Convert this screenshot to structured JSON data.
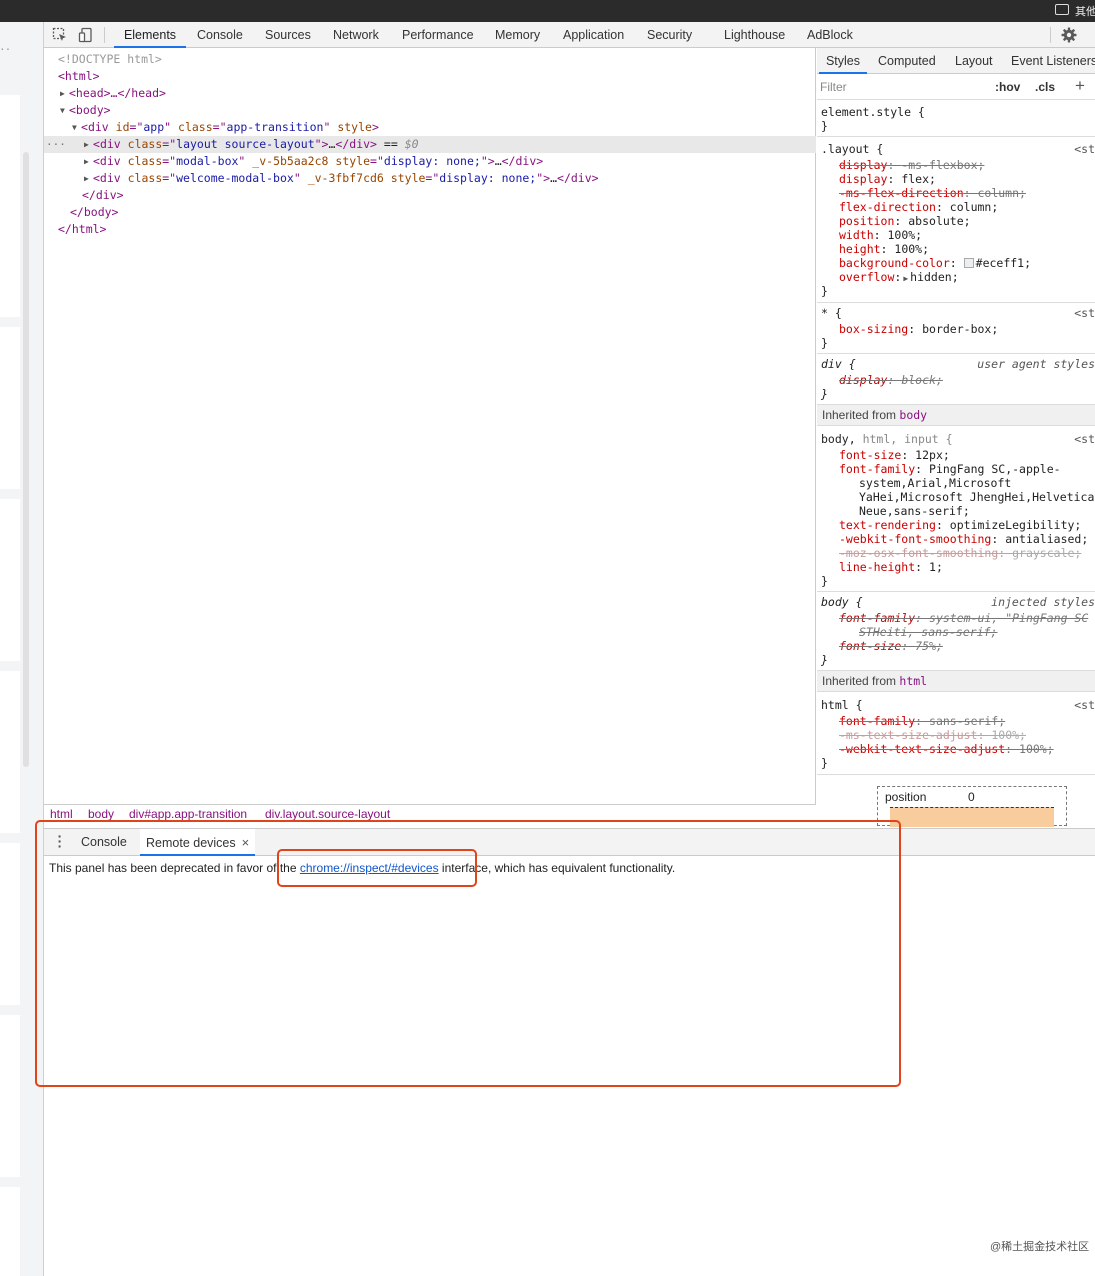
{
  "topbar": {
    "corner_text": "其他"
  },
  "leftstrip": {
    "dots": "··"
  },
  "toolbar": {
    "tabs": [
      "Elements",
      "Console",
      "Sources",
      "Network",
      "Performance",
      "Memory",
      "Application",
      "Security",
      "Lighthouse",
      "AdBlock"
    ],
    "active_tab": "Elements",
    "icons": [
      "inspect-element-icon",
      "device-toolbar-icon",
      "gear-icon"
    ]
  },
  "dom": {
    "doctype": "<!DOCTYPE html>",
    "html_open": "<html>",
    "head": "<head>…</head>",
    "body_open": "<body>",
    "app_div": {
      "tag": "div",
      "id_attr": "id",
      "id_val": "app",
      "class_attr": "class",
      "class_val": "app-transition",
      "style_attr": "style"
    },
    "selected_div": {
      "tag": "div",
      "class_attr": "class",
      "class_val": "layout source-layout",
      "ellipsis": "…",
      "close": "</div>",
      "eq": "==",
      "dollar": "$0",
      "dots": "···"
    },
    "modal_div": {
      "class_val": "modal-box",
      "scope": "_v-5b5aa2c8",
      "style_attr": "style",
      "style_val": "display: none;",
      "ellipsis": "…",
      "close": "</div>"
    },
    "welcome_div": {
      "class_val": "welcome-modal-box",
      "scope": "_v-3fbf7cd6",
      "style_attr": "style",
      "style_val": "display: none;",
      "ellipsis": "…",
      "close": "</div>"
    },
    "div_close": "</div>",
    "body_close": "</body>",
    "html_close": "</html>"
  },
  "breadcrumb": [
    "html",
    "body",
    "div#app.app-transition",
    "div.layout.source-layout"
  ],
  "sidebar": {
    "tabs": [
      "Styles",
      "Computed",
      "Layout",
      "Event Listeners"
    ],
    "active_tab": "Styles",
    "filter_placeholder": "Filter",
    "hov": ":hov",
    "cls": ".cls",
    "plus": "+",
    "element_style": "element.style {",
    "close_brace": "}",
    "layout_rule": {
      "selector": ".layout {",
      "source": "<st",
      "decls": [
        {
          "p": "display",
          "v": "-ms-flexbox;",
          "struck": true
        },
        {
          "p": "display",
          "v": "flex;",
          "struck": false
        },
        {
          "p": "-ms-flex-direction",
          "v": "column;",
          "struck": true
        },
        {
          "p": "flex-direction",
          "v": "column;",
          "struck": false
        },
        {
          "p": "position",
          "v": "absolute;",
          "struck": false
        },
        {
          "p": "width",
          "v": "100%;",
          "struck": false
        },
        {
          "p": "height",
          "v": "100%;",
          "struck": false
        },
        {
          "p": "background-color",
          "v": "#eceff1;",
          "struck": false
        },
        {
          "p": "overflow",
          "v": "hidden;",
          "struck": false
        }
      ]
    },
    "star_rule": {
      "selector": "* {",
      "source": "<st",
      "p": "box-sizing",
      "v": "border-box;"
    },
    "div_rule": {
      "selector": "div {",
      "source": "user agent styles",
      "p": "display",
      "v": "block;"
    },
    "inherited_body": {
      "label": "Inherited from",
      "tag": "body"
    },
    "body_rule": {
      "selector_a": "body,",
      "selector_b": "html, input {",
      "source": "<st",
      "font_size_p": "font-size",
      "font_size_v": "12px;",
      "ff_p": "font-family",
      "ff_v1": "PingFang SC,-apple-",
      "ff_v2": "system,Arial,Microsoft",
      "ff_v3": "YaHei,Microsoft JhengHei,Helvetica",
      "ff_v4": "Neue,sans-serif;",
      "tr_p": "text-rendering",
      "tr_v": "optimizeLegibility;",
      "wfs_p": "-webkit-font-smoothing",
      "wfs_v": "antialiased;",
      "moz_p": "-moz-osx-font-smoothing",
      "moz_v": "grayscale;",
      "lh_p": "line-height",
      "lh_v": "1;"
    },
    "body_injected": {
      "selector": "body {",
      "source": "injected styles",
      "ff_p": "font-family",
      "ff_v1": "system-ui, \"PingFang SC",
      "ff_v2": "STHeiti, sans-serif;",
      "fs_p": "font-size",
      "fs_v": "75%;"
    },
    "inherited_html": {
      "label": "Inherited from",
      "tag": "html"
    },
    "html_rule": {
      "selector": "html {",
      "source": "<st",
      "ff_p": "font-family",
      "ff_v": "sans-serif;",
      "ms_p": "-ms-text-size-adjust",
      "ms_v": "100%;",
      "wk_p": "-webkit-text-size-adjust",
      "wk_v": "100%;"
    },
    "boxmodel": {
      "label": "position",
      "value": "0"
    }
  },
  "drawer": {
    "tabs": [
      "Console",
      "Remote devices"
    ],
    "active_tab": "Remote devices",
    "close_glyph": "×",
    "message_before": "This panel has been deprecated in favor of the ",
    "link": "chrome://inspect/#devices",
    "message_after": " interface, which has equivalent functionality."
  },
  "annotation_color": "#e0441b",
  "watermark": "@稀土掘金技术社区"
}
